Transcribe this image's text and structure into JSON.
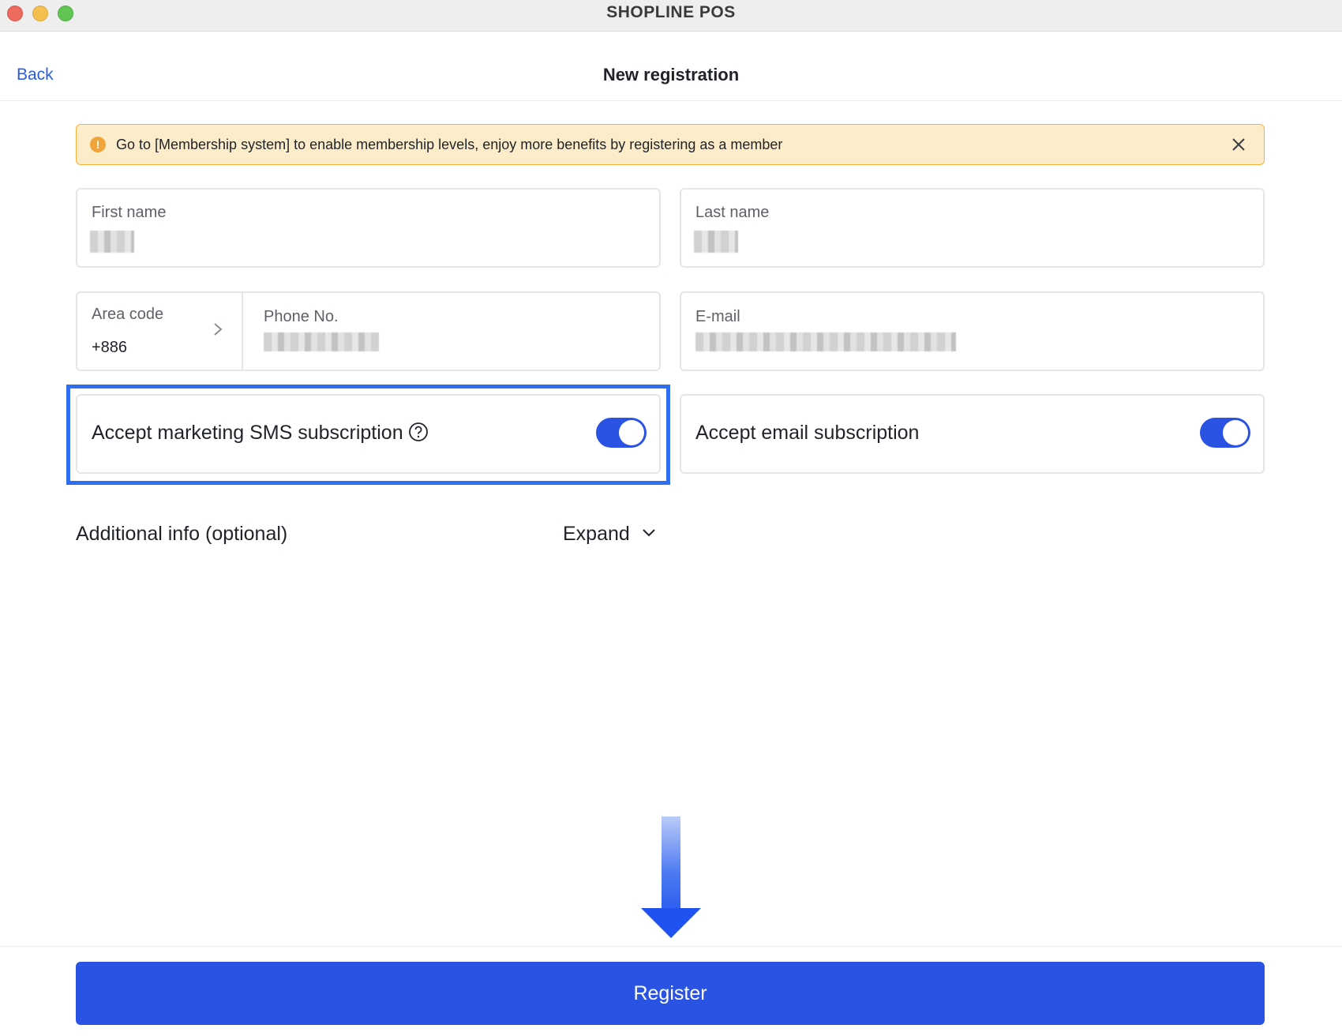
{
  "window": {
    "title": "SHOPLINE POS",
    "traffic_lights": [
      "close",
      "minimize",
      "zoom"
    ]
  },
  "header": {
    "back_label": "Back",
    "page_title": "New registration"
  },
  "banner": {
    "message": "Go to [Membership system] to enable membership levels, enjoy more benefits by registering as a member",
    "icon": "warning-icon",
    "close_icon": "close-icon",
    "background": "#fcecc9",
    "border": "#f6b040"
  },
  "form": {
    "first_name": {
      "label": "First name",
      "value_redacted": true
    },
    "last_name": {
      "label": "Last name",
      "value_redacted": true
    },
    "area_code": {
      "label": "Area code",
      "value": "+886"
    },
    "phone": {
      "label": "Phone No.",
      "value_redacted": true
    },
    "email": {
      "label": "E-mail",
      "value_redacted": true
    },
    "sms_subscription": {
      "label": "Accept marketing SMS subscription",
      "enabled": true,
      "help_icon": "question-circle-icon"
    },
    "email_subscription": {
      "label": "Accept email subscription",
      "enabled": true
    }
  },
  "additional_info": {
    "label": "Additional info (optional)",
    "expand_label": "Expand"
  },
  "footer": {
    "register_label": "Register"
  },
  "colors": {
    "accent": "#2a53e4",
    "link": "#2d5be3",
    "highlight": "#2f6ef0"
  }
}
